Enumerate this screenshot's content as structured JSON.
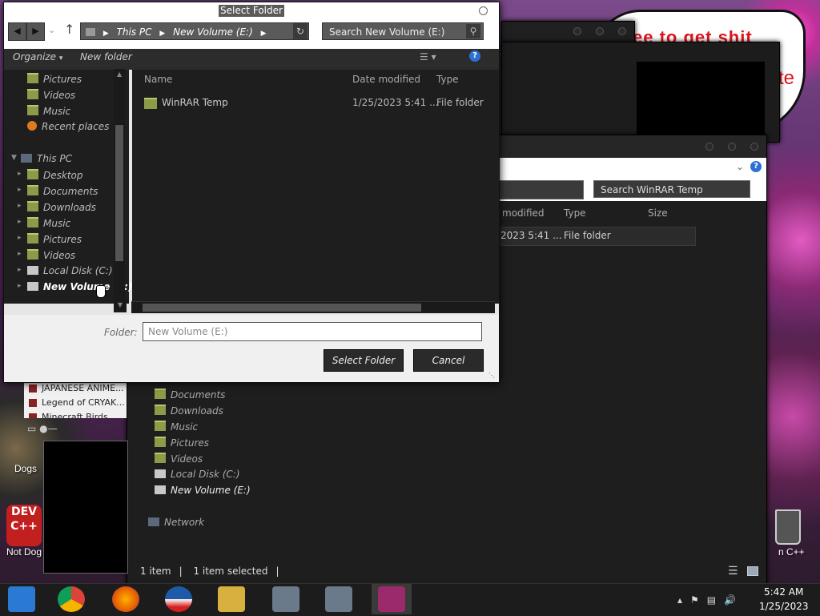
{
  "dialog": {
    "title": "Select Folder",
    "breadcrumb": [
      "This PC",
      "New Volume (E:)"
    ],
    "search_placeholder": "Search New Volume (E:)",
    "toolbar": {
      "organize": "Organize",
      "new_folder": "New folder"
    },
    "nav": {
      "quick": [
        "Pictures",
        "Videos",
        "Music",
        "Recent places"
      ],
      "this_pc": "This PC",
      "pc_items": [
        "Desktop",
        "Documents",
        "Downloads",
        "Music",
        "Pictures",
        "Videos",
        "Local Disk (C:)",
        "New Volume (E:)"
      ],
      "selected": "New Volume (E:)"
    },
    "columns": {
      "name": "Name",
      "date": "Date modified",
      "type": "Type"
    },
    "rows": [
      {
        "name": "WinRAR Temp",
        "date": "1/25/2023 5:41 ...",
        "type": "File folder"
      }
    ],
    "folder_label": "Folder:",
    "folder_value": "New Volume (E:)",
    "select_button": "Select Folder",
    "cancel_button": "Cancel"
  },
  "explorer_bg": {
    "search_placeholder": "Search WinRAR Temp",
    "columns": {
      "modified": "modified",
      "type": "Type",
      "size": "Size"
    },
    "row": {
      "date": "2023 5:41 ...",
      "type": "File folder"
    },
    "nav": [
      "Documents",
      "Downloads",
      "Music",
      "Pictures",
      "Videos",
      "Local Disk (C:)",
      "New Volume (E:)"
    ],
    "network": "Network",
    "status": {
      "items": "1 item",
      "selected": "1 item selected"
    }
  },
  "recent_list": [
    "JAPANESE ANIME...",
    "Legend of CRYAK...",
    "Minecraft Birds"
  ],
  "desktop": {
    "bubble_text": "ee to get shit",
    "bubble_text2": "te",
    "dogs_label": "Dogs",
    "notdog_label": "Not Dog",
    "cpp_label": "n C++",
    "dev_icon_text": "DEV C++"
  },
  "taskbar": {
    "time": "5:42 AM",
    "date": "1/25/2023",
    "apps": [
      "explorer-app",
      "chrome-app",
      "firefox-app",
      "obama-app",
      "folder-app",
      "setup-app-1",
      "setup-app-2",
      "winrar-app"
    ]
  },
  "colors": {
    "accent_blue": "#2d6fd4",
    "folder_green": "#8a9b4a",
    "dark_bg": "#1e1e1e"
  }
}
